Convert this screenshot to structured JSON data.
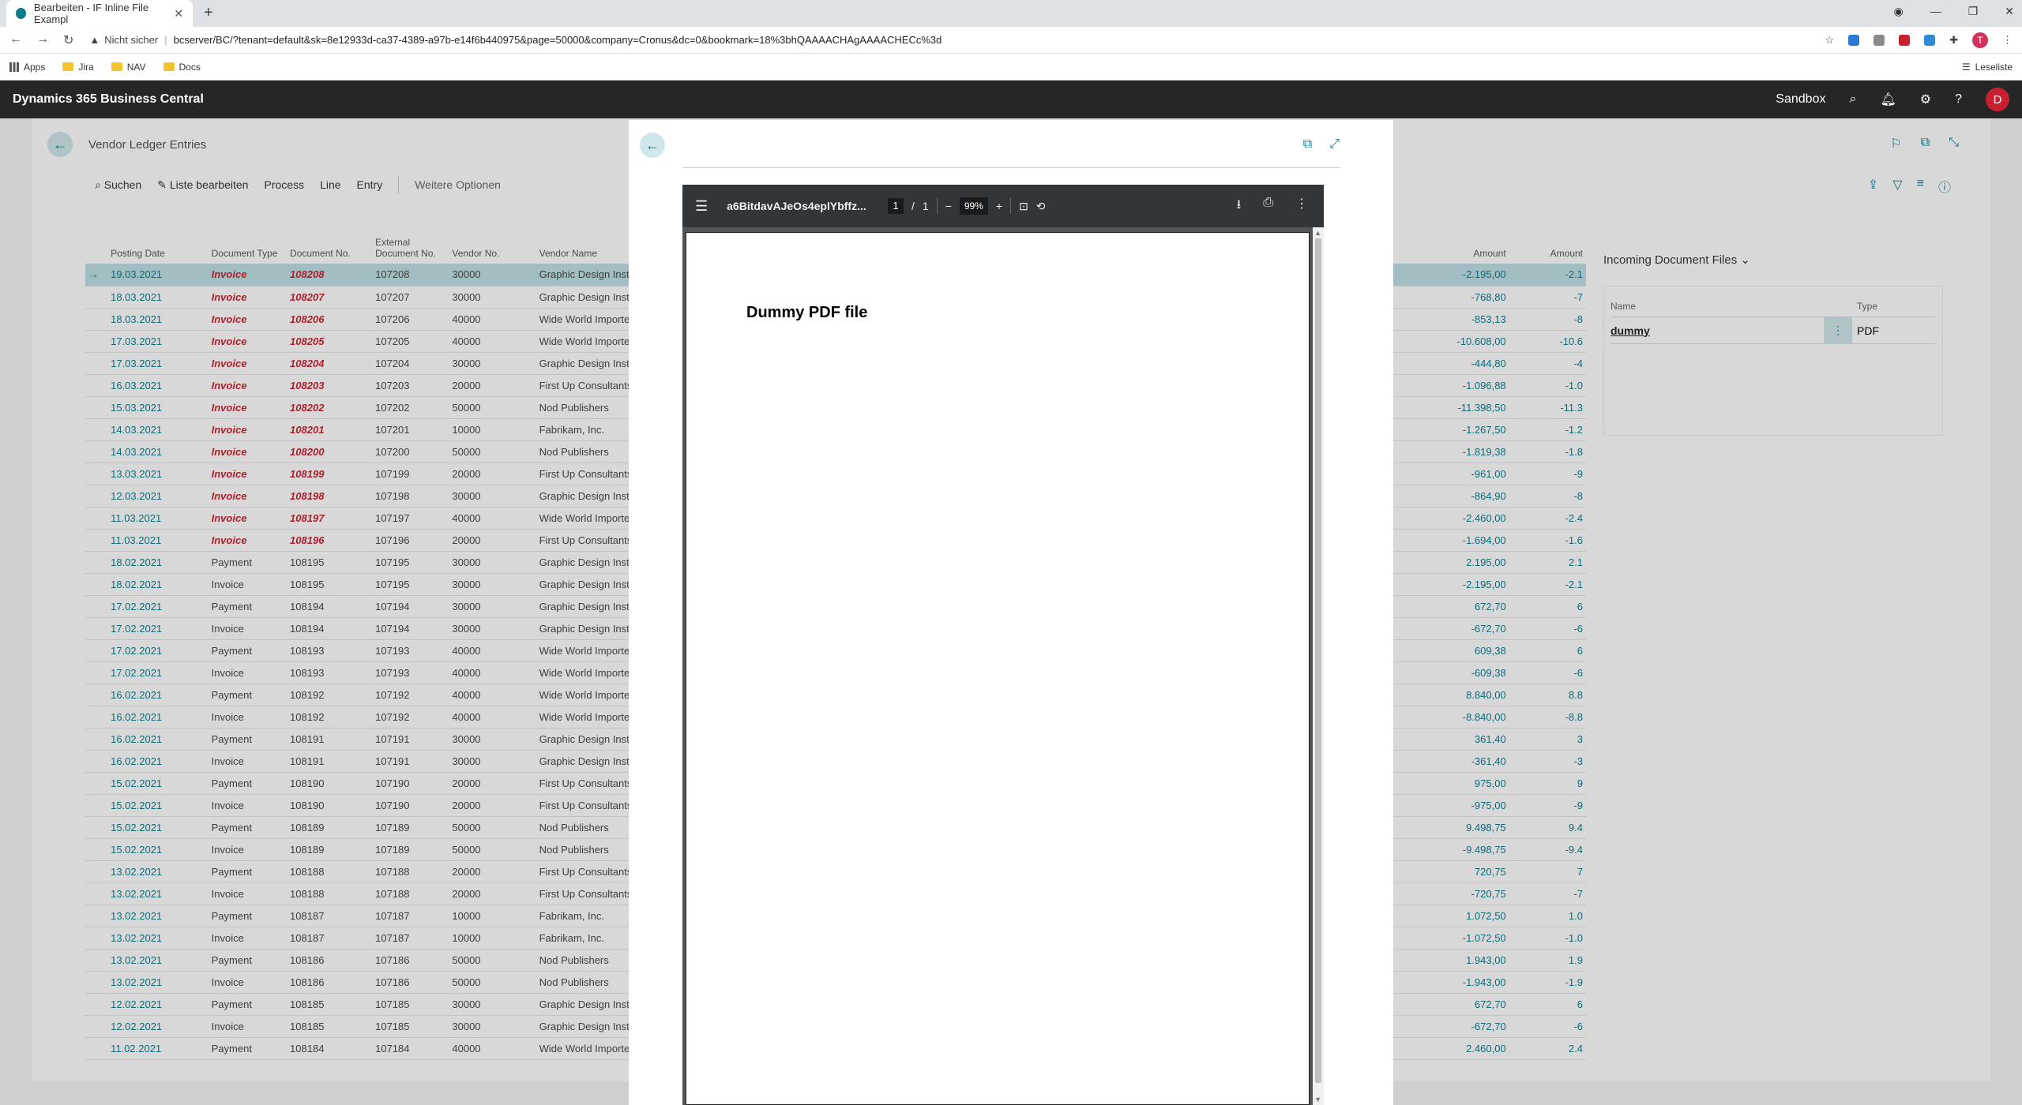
{
  "browser": {
    "tab_title": "Bearbeiten - IF Inline File Exampl",
    "new_tab": "+",
    "security": "Nicht sicher",
    "url": "bcserver/BC/?tenant=default&sk=8e12933d-ca37-4389-a97b-e14f6b440975&page=50000&company=Cronus&dc=0&bookmark=18%3bhQAAAACHAgAAAACHECc%3d",
    "profile_initial": "T",
    "bookmarks": [
      "Apps",
      "Jira",
      "NAV",
      "Docs"
    ],
    "reading_list": "Leseliste"
  },
  "bc": {
    "brand": "Dynamics 365 Business Central",
    "environment": "Sandbox",
    "user_initial": "D"
  },
  "page": {
    "title": "Vendor Ledger Entries",
    "actions": [
      "Suchen",
      "Liste bearbeiten",
      "Process",
      "Line",
      "Entry",
      "Weitere Optionen"
    ]
  },
  "table": {
    "headers": {
      "posting_date": "Posting Date",
      "document_type": "Document Type",
      "document_no": "Document No.",
      "external_document_no": "External Document No.",
      "vendor_no": "Vendor No.",
      "vendor_name": "Vendor Name",
      "amount": "Amount",
      "amount2": "Amount"
    },
    "rows": [
      [
        "19.03.2021",
        "Invoice",
        "108208",
        "107208",
        "30000",
        "Graphic Design Institute",
        "-2.195,00",
        "-2.1"
      ],
      [
        "18.03.2021",
        "Invoice",
        "108207",
        "107207",
        "30000",
        "Graphic Design Institute",
        "-768,80",
        "-7"
      ],
      [
        "18.03.2021",
        "Invoice",
        "108206",
        "107206",
        "40000",
        "Wide World Importers",
        "-853,13",
        "-8"
      ],
      [
        "17.03.2021",
        "Invoice",
        "108205",
        "107205",
        "40000",
        "Wide World Importers",
        "-10.608,00",
        "-10.6"
      ],
      [
        "17.03.2021",
        "Invoice",
        "108204",
        "107204",
        "30000",
        "Graphic Design Institute",
        "-444,80",
        "-4"
      ],
      [
        "16.03.2021",
        "Invoice",
        "108203",
        "107203",
        "20000",
        "First Up Consultants",
        "-1.096,88",
        "-1.0"
      ],
      [
        "15.03.2021",
        "Invoice",
        "108202",
        "107202",
        "50000",
        "Nod Publishers",
        "-11.398,50",
        "-11.3"
      ],
      [
        "14.03.2021",
        "Invoice",
        "108201",
        "107201",
        "10000",
        "Fabrikam, Inc.",
        "-1.267,50",
        "-1.2"
      ],
      [
        "14.03.2021",
        "Invoice",
        "108200",
        "107200",
        "50000",
        "Nod Publishers",
        "-1.819,38",
        "-1.8"
      ],
      [
        "13.03.2021",
        "Invoice",
        "108199",
        "107199",
        "20000",
        "First Up Consultants",
        "-961,00",
        "-9"
      ],
      [
        "12.03.2021",
        "Invoice",
        "108198",
        "107198",
        "30000",
        "Graphic Design Institute",
        "-864,90",
        "-8"
      ],
      [
        "11.03.2021",
        "Invoice",
        "108197",
        "107197",
        "40000",
        "Wide World Importers",
        "-2.460,00",
        "-2.4"
      ],
      [
        "11.03.2021",
        "Invoice",
        "108196",
        "107196",
        "20000",
        "First Up Consultants",
        "-1.694,00",
        "-1.6"
      ],
      [
        "18.02.2021",
        "Payment",
        "108195",
        "107195",
        "30000",
        "Graphic Design Institute",
        "2.195,00",
        "2.1"
      ],
      [
        "18.02.2021",
        "Invoice",
        "108195",
        "107195",
        "30000",
        "Graphic Design Institute",
        "-2.195,00",
        "-2.1"
      ],
      [
        "17.02.2021",
        "Payment",
        "108194",
        "107194",
        "30000",
        "Graphic Design Institute",
        "672,70",
        "6"
      ],
      [
        "17.02.2021",
        "Invoice",
        "108194",
        "107194",
        "30000",
        "Graphic Design Institute",
        "-672,70",
        "-6"
      ],
      [
        "17.02.2021",
        "Payment",
        "108193",
        "107193",
        "40000",
        "Wide World Importers",
        "609,38",
        "6"
      ],
      [
        "17.02.2021",
        "Invoice",
        "108193",
        "107193",
        "40000",
        "Wide World Importers",
        "-609,38",
        "-6"
      ],
      [
        "16.02.2021",
        "Payment",
        "108192",
        "107192",
        "40000",
        "Wide World Importers",
        "8.840,00",
        "8.8"
      ],
      [
        "16.02.2021",
        "Invoice",
        "108192",
        "107192",
        "40000",
        "Wide World Importers",
        "-8.840,00",
        "-8.8"
      ],
      [
        "16.02.2021",
        "Payment",
        "108191",
        "107191",
        "30000",
        "Graphic Design Institute",
        "361,40",
        "3"
      ],
      [
        "16.02.2021",
        "Invoice",
        "108191",
        "107191",
        "30000",
        "Graphic Design Institute",
        "-361,40",
        "-3"
      ],
      [
        "15.02.2021",
        "Payment",
        "108190",
        "107190",
        "20000",
        "First Up Consultants",
        "975,00",
        "9"
      ],
      [
        "15.02.2021",
        "Invoice",
        "108190",
        "107190",
        "20000",
        "First Up Consultants",
        "-975,00",
        "-9"
      ],
      [
        "15.02.2021",
        "Payment",
        "108189",
        "107189",
        "50000",
        "Nod Publishers",
        "9.498,75",
        "9.4"
      ],
      [
        "15.02.2021",
        "Invoice",
        "108189",
        "107189",
        "50000",
        "Nod Publishers",
        "-9.498,75",
        "-9.4"
      ],
      [
        "13.02.2021",
        "Payment",
        "108188",
        "107188",
        "20000",
        "First Up Consultants",
        "720,75",
        "7"
      ],
      [
        "13.02.2021",
        "Invoice",
        "108188",
        "107188",
        "20000",
        "First Up Consultants",
        "-720,75",
        "-7"
      ],
      [
        "13.02.2021",
        "Payment",
        "108187",
        "107187",
        "10000",
        "Fabrikam, Inc.",
        "1.072,50",
        "1.0"
      ],
      [
        "13.02.2021",
        "Invoice",
        "108187",
        "107187",
        "10000",
        "Fabrikam, Inc.",
        "-1.072,50",
        "-1.0"
      ],
      [
        "13.02.2021",
        "Payment",
        "108186",
        "107186",
        "50000",
        "Nod Publishers",
        "1.943,00",
        "1.9"
      ],
      [
        "13.02.2021",
        "Invoice",
        "108186",
        "107186",
        "50000",
        "Nod Publishers",
        "-1.943,00",
        "-1.9"
      ],
      [
        "12.02.2021",
        "Payment",
        "108185",
        "107185",
        "30000",
        "Graphic Design Institute",
        "672,70",
        "6"
      ],
      [
        "12.02.2021",
        "Invoice",
        "108185",
        "107185",
        "30000",
        "Graphic Design Institute",
        "-672,70",
        "-6"
      ],
      [
        "11.02.2021",
        "Payment",
        "108184",
        "107184",
        "40000",
        "Wide World Importers",
        "2.460,00",
        "2.4"
      ]
    ],
    "highlighted_rows": 13
  },
  "factbox": {
    "title": "Incoming Document Files",
    "col_name": "Name",
    "col_type": "Type",
    "file_name": "dummy",
    "file_type": "PDF"
  },
  "pdf": {
    "file_name": "a6BitdavAJeOs4eplYbffz...",
    "page_current": "1",
    "page_total": "1",
    "zoom": "99%",
    "content_title": "Dummy PDF file"
  }
}
